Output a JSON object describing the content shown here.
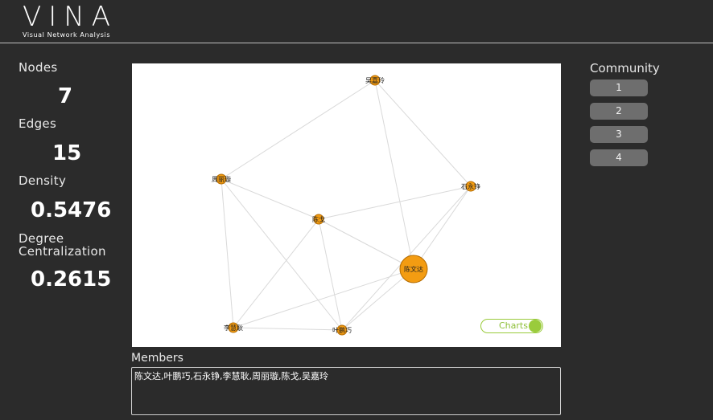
{
  "app": {
    "title": "VINA",
    "subtitle": "Visual Network Analysis"
  },
  "stats": {
    "nodes_label": "Nodes",
    "nodes_value": "7",
    "edges_label": "Edges",
    "edges_value": "15",
    "density_label": "Density",
    "density_value": "0.5476",
    "centralization_label_1": "Degree",
    "centralization_label_2": "Centralization",
    "centralization_value": "0.2615"
  },
  "graph": {
    "nodes": [
      {
        "id": "wu",
        "label": "吴嘉玲"
      },
      {
        "id": "zhou",
        "label": "周丽璇"
      },
      {
        "id": "shi",
        "label": "石永铮"
      },
      {
        "id": "chenge",
        "label": "陈戈"
      },
      {
        "id": "chenwenda",
        "label": "陈文达"
      },
      {
        "id": "li",
        "label": "李慧耿"
      },
      {
        "id": "ye",
        "label": "叶鹏巧"
      }
    ],
    "edges": [
      [
        "wu",
        "zhou"
      ],
      [
        "wu",
        "shi"
      ],
      [
        "wu",
        "chenwenda"
      ],
      [
        "zhou",
        "chenge"
      ],
      [
        "zhou",
        "li"
      ],
      [
        "zhou",
        "ye"
      ],
      [
        "shi",
        "chenge"
      ],
      [
        "shi",
        "chenwenda"
      ],
      [
        "shi",
        "ye"
      ],
      [
        "chenge",
        "chenwenda"
      ],
      [
        "chenge",
        "li"
      ],
      [
        "chenge",
        "ye"
      ],
      [
        "chenwenda",
        "li"
      ],
      [
        "chenwenda",
        "ye"
      ],
      [
        "li",
        "ye"
      ]
    ],
    "node_color": "#f39c12",
    "node_stroke": "#b36b00",
    "edge_color": "#d9d9d9",
    "charts_toggle_label": "Charts"
  },
  "members": {
    "label": "Members",
    "text": "陈文达,叶鹏巧,石永铮,李慧耿,周丽璇,陈戈,吴嘉玲"
  },
  "community": {
    "title": "Community",
    "items": [
      "1",
      "2",
      "3",
      "4"
    ]
  }
}
